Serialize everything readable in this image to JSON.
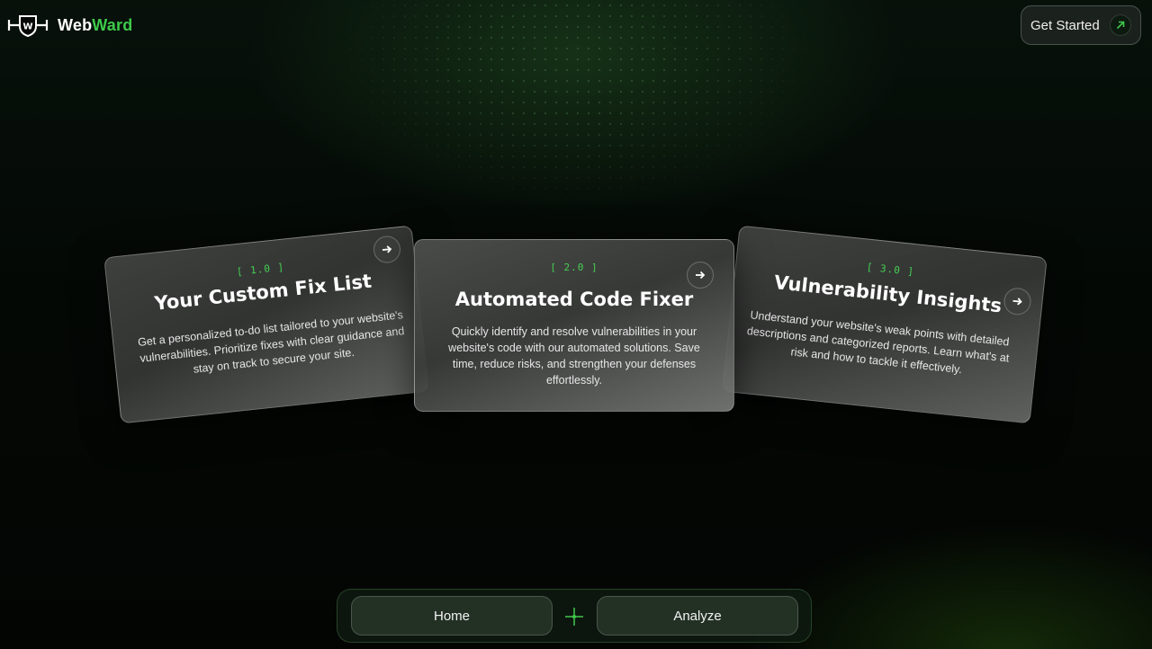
{
  "brand": {
    "name_part1": "Web",
    "name_part2": "Ward",
    "accent": "#3ec94a"
  },
  "header": {
    "cta_label": "Get Started",
    "cta_icon": "arrow-up-right-icon"
  },
  "cards": [
    {
      "number": "[ 1.0 ]",
      "title": "Your Custom Fix List",
      "description": "Get a personalized to-do list tailored to your website's vulnerabilities. Prioritize fixes with clear guidance and stay on track to secure your site.",
      "icon": "arrow-right-icon"
    },
    {
      "number": "[ 2.0 ]",
      "title": "Automated Code Fixer",
      "description": "Quickly identify and resolve vulnerabilities in your website's code with our automated solutions. Save time, reduce risks, and strengthen your defenses effortlessly.",
      "icon": "arrow-right-icon"
    },
    {
      "number": "[ 3.0 ]",
      "title": "Vulnerability Insights",
      "description": "Understand your website's weak points with detailed descriptions and categorized reports. Learn what's at risk and how to tackle it effectively.",
      "icon": "arrow-right-icon"
    }
  ],
  "bottom_nav": {
    "home_label": "Home",
    "analyze_label": "Analyze",
    "divider_icon": "crosshair-icon"
  }
}
